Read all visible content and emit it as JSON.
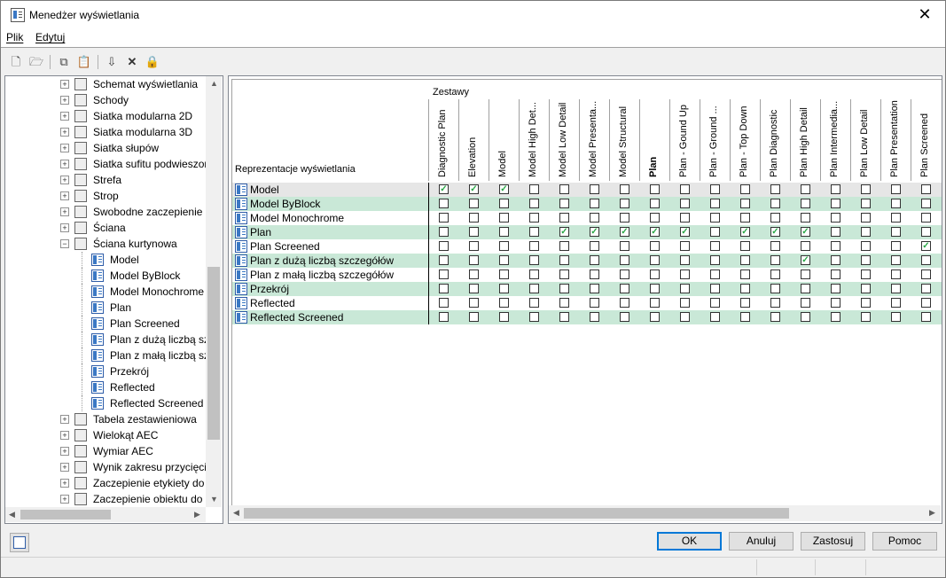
{
  "window": {
    "title": "Menedżer wyświetlania",
    "close_icon": "close-icon"
  },
  "menu": {
    "items": [
      "Plik",
      "Edytuj"
    ]
  },
  "toolbar": {
    "icons": [
      "new-icon",
      "open-icon",
      "copy-icon",
      "paste-icon",
      "import-icon",
      "delete-icon",
      "lock-icon"
    ]
  },
  "tree": {
    "items": [
      {
        "label": "Schemat wyświetlania",
        "icon": "display-schema-icon",
        "level": 0,
        "expander": "+"
      },
      {
        "label": "Schody",
        "icon": "stairs-icon",
        "level": 0,
        "expander": "+"
      },
      {
        "label": "Siatka modularna 2D",
        "icon": "grid-2d-icon",
        "level": 0,
        "expander": "+"
      },
      {
        "label": "Siatka modularna 3D",
        "icon": "grid-3d-icon",
        "level": 0,
        "expander": "+"
      },
      {
        "label": "Siatka słupów",
        "icon": "column-grid-icon",
        "level": 0,
        "expander": "+"
      },
      {
        "label": "Siatka sufitu podwieszon",
        "icon": "ceiling-grid-icon",
        "level": 0,
        "expander": "+"
      },
      {
        "label": "Strefa",
        "icon": "zone-icon",
        "level": 0,
        "expander": "+"
      },
      {
        "label": "Strop",
        "icon": "slab-icon",
        "level": 0,
        "expander": "+"
      },
      {
        "label": "Swobodne zaczepienie",
        "icon": "anchor-icon",
        "level": 0,
        "expander": "+"
      },
      {
        "label": "Ściana",
        "icon": "wall-icon",
        "level": 0,
        "expander": "+"
      },
      {
        "label": "Ściana kurtynowa",
        "icon": "curtain-wall-icon",
        "level": 0,
        "expander": "−"
      },
      {
        "label": "Model",
        "icon": "representation-icon",
        "level": 1
      },
      {
        "label": "Model ByBlock",
        "icon": "representation-icon",
        "level": 1
      },
      {
        "label": "Model Monochrome",
        "icon": "representation-icon",
        "level": 1
      },
      {
        "label": "Plan",
        "icon": "representation-icon",
        "level": 1
      },
      {
        "label": "Plan Screened",
        "icon": "representation-icon",
        "level": 1
      },
      {
        "label": "Plan z dużą liczbą szc",
        "icon": "representation-icon",
        "level": 1
      },
      {
        "label": "Plan z małą liczbą szc",
        "icon": "representation-icon",
        "level": 1
      },
      {
        "label": "Przekrój",
        "icon": "representation-icon",
        "level": 1
      },
      {
        "label": "Reflected",
        "icon": "representation-icon",
        "level": 1
      },
      {
        "label": "Reflected Screened",
        "icon": "representation-icon",
        "level": 1
      },
      {
        "label": "Tabela zestawieniowa",
        "icon": "schedule-table-icon",
        "level": 0,
        "expander": "+"
      },
      {
        "label": "Wielokąt AEC",
        "icon": "polygon-icon",
        "level": 0,
        "expander": "+"
      },
      {
        "label": "Wymiar AEC",
        "icon": "dimension-icon",
        "level": 0,
        "expander": "+"
      },
      {
        "label": "Wynik zakresu przycięcia",
        "icon": "clip-result-icon",
        "level": 0,
        "expander": "+"
      },
      {
        "label": "Zaczepienie etykiety do",
        "icon": "tag-anchor-icon",
        "level": 0,
        "expander": "+"
      },
      {
        "label": "Zaczepienie obiektu do s",
        "icon": "object-anchor-icon",
        "level": 0,
        "expander": "+"
      }
    ]
  },
  "grid": {
    "reps_header": "Reprezentacje wyświetlania",
    "sets_header": "Zestawy",
    "columns": [
      {
        "label": "Diagnostic Plan",
        "bold": false
      },
      {
        "label": "Elevation",
        "bold": false
      },
      {
        "label": "Model",
        "bold": false
      },
      {
        "label": "Model High Det...",
        "bold": false
      },
      {
        "label": "Model Low Detail",
        "bold": false
      },
      {
        "label": "Model Presenta...",
        "bold": false
      },
      {
        "label": "Model Structural",
        "bold": false
      },
      {
        "label": "Plan",
        "bold": true
      },
      {
        "label": "Plan - Gound Up",
        "bold": false
      },
      {
        "label": "Plan - Ground ...",
        "bold": false
      },
      {
        "label": "Plan - Top Down",
        "bold": false
      },
      {
        "label": "Plan Diagnostic",
        "bold": false
      },
      {
        "label": "Plan High Detail",
        "bold": false
      },
      {
        "label": "Plan Intermedia...",
        "bold": false
      },
      {
        "label": "Plan Low Detail",
        "bold": false
      },
      {
        "label": "Plan Presentation",
        "bold": false
      },
      {
        "label": "Plan Screened",
        "bold": false
      }
    ],
    "rows": [
      {
        "name": "Model",
        "style": "sel",
        "checks": [
          1,
          1,
          1,
          0,
          0,
          0,
          0,
          0,
          0,
          0,
          0,
          0,
          0,
          0,
          0,
          0,
          0
        ]
      },
      {
        "name": "Model ByBlock",
        "style": "alt",
        "checks": [
          0,
          0,
          0,
          0,
          0,
          0,
          0,
          0,
          0,
          0,
          0,
          0,
          0,
          0,
          0,
          0,
          0
        ]
      },
      {
        "name": "Model Monochrome",
        "style": "",
        "checks": [
          0,
          0,
          0,
          0,
          0,
          0,
          0,
          0,
          0,
          0,
          0,
          0,
          0,
          0,
          0,
          0,
          0
        ]
      },
      {
        "name": "Plan",
        "style": "alt",
        "checks": [
          0,
          0,
          0,
          0,
          1,
          1,
          1,
          1,
          1,
          0,
          1,
          1,
          1,
          0,
          0,
          0,
          0
        ]
      },
      {
        "name": "Plan Screened",
        "style": "",
        "checks": [
          0,
          0,
          0,
          0,
          0,
          0,
          0,
          0,
          0,
          0,
          0,
          0,
          0,
          0,
          0,
          0,
          1
        ]
      },
      {
        "name": "Plan z dużą liczbą szczegółów",
        "style": "alt",
        "checks": [
          0,
          0,
          0,
          0,
          0,
          0,
          0,
          0,
          0,
          0,
          0,
          0,
          1,
          0,
          0,
          0,
          0
        ]
      },
      {
        "name": "Plan z małą liczbą szczegółów",
        "style": "",
        "checks": [
          0,
          0,
          0,
          0,
          0,
          0,
          0,
          0,
          0,
          0,
          0,
          0,
          0,
          0,
          0,
          0,
          0
        ]
      },
      {
        "name": "Przekrój",
        "style": "alt",
        "checks": [
          0,
          0,
          0,
          0,
          0,
          0,
          0,
          0,
          0,
          0,
          0,
          0,
          0,
          0,
          0,
          0,
          0
        ]
      },
      {
        "name": "Reflected",
        "style": "",
        "checks": [
          0,
          0,
          0,
          0,
          0,
          0,
          0,
          0,
          0,
          0,
          0,
          0,
          0,
          0,
          0,
          0,
          0
        ]
      },
      {
        "name": "Reflected Screened",
        "style": "alt",
        "checks": [
          0,
          0,
          0,
          0,
          0,
          0,
          0,
          0,
          0,
          0,
          0,
          0,
          0,
          0,
          0,
          0,
          0
        ]
      }
    ],
    "check_color": "#28a745",
    "alt_row_color": "#c9e8d7"
  },
  "buttons": {
    "ok": "OK",
    "cancel": "Anuluj",
    "apply": "Zastosuj",
    "help": "Pomoc"
  },
  "bottom": {
    "help_icon": "display-manager-help-icon"
  }
}
